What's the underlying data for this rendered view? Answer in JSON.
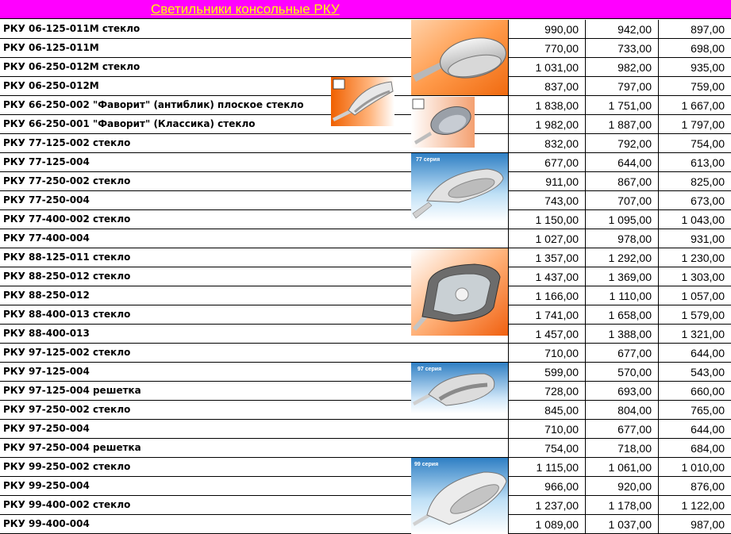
{
  "title": "Светильники консольные РКУ",
  "rows": [
    {
      "name": "РКУ 06-125-011М стекло",
      "p1": "990,00",
      "p2": "942,00",
      "p3": "897,00"
    },
    {
      "name": "РКУ 06-125-011М",
      "p1": "770,00",
      "p2": "733,00",
      "p3": "698,00"
    },
    {
      "name": "РКУ 06-250-012М стекло",
      "p1": "1 031,00",
      "p2": "982,00",
      "p3": "935,00"
    },
    {
      "name": "РКУ 06-250-012М",
      "p1": "837,00",
      "p2": "797,00",
      "p3": "759,00"
    },
    {
      "name": "РКУ 66-250-002 \"Фаворит\" (антиблик) плоское стекло",
      "p1": "1 838,00",
      "p2": "1 751,00",
      "p3": "1 667,00"
    },
    {
      "name": "РКУ 66-250-001 \"Фаворит\" (Классика) стекло",
      "p1": "1 982,00",
      "p2": "1 887,00",
      "p3": "1 797,00"
    },
    {
      "name": "РКУ 77-125-002 стекло",
      "p1": "832,00",
      "p2": "792,00",
      "p3": "754,00"
    },
    {
      "name": "РКУ 77-125-004",
      "p1": "677,00",
      "p2": "644,00",
      "p3": "613,00"
    },
    {
      "name": "РКУ 77-250-002 стекло",
      "p1": "911,00",
      "p2": "867,00",
      "p3": "825,00"
    },
    {
      "name": "РКУ 77-250-004",
      "p1": "743,00",
      "p2": "707,00",
      "p3": "673,00"
    },
    {
      "name": "РКУ 77-400-002 стекло",
      "p1": "1 150,00",
      "p2": "1 095,00",
      "p3": "1 043,00"
    },
    {
      "name": "РКУ 77-400-004",
      "p1": "1 027,00",
      "p2": "978,00",
      "p3": "931,00"
    },
    {
      "name": "РКУ 88-125-011 стекло",
      "p1": "1 357,00",
      "p2": "1 292,00",
      "p3": "1 230,00"
    },
    {
      "name": "РКУ 88-250-012 стекло",
      "p1": "1 437,00",
      "p2": "1 369,00",
      "p3": "1 303,00"
    },
    {
      "name": "РКУ 88-250-012",
      "p1": "1 166,00",
      "p2": "1 110,00",
      "p3": "1 057,00"
    },
    {
      "name": "РКУ 88-400-013 стекло",
      "p1": "1 741,00",
      "p2": "1 658,00",
      "p3": "1 579,00"
    },
    {
      "name": "РКУ 88-400-013",
      "p1": "1 457,00",
      "p2": "1 388,00",
      "p3": "1 321,00"
    },
    {
      "name": "РКУ 97-125-002 стекло",
      "p1": "710,00",
      "p2": "677,00",
      "p3": "644,00"
    },
    {
      "name": "РКУ 97-125-004",
      "p1": "599,00",
      "p2": "570,00",
      "p3": "543,00"
    },
    {
      "name": "РКУ 97-125-004 решетка",
      "p1": "728,00",
      "p2": "693,00",
      "p3": "660,00"
    },
    {
      "name": "РКУ 97-250-002 стекло",
      "p1": "845,00",
      "p2": "804,00",
      "p3": "765,00"
    },
    {
      "name": "РКУ 97-250-004",
      "p1": "710,00",
      "p2": "677,00",
      "p3": "644,00"
    },
    {
      "name": "РКУ 97-250-004 решетка",
      "p1": "754,00",
      "p2": "718,00",
      "p3": "684,00"
    },
    {
      "name": "РКУ 99-250-002 стекло",
      "p1": "1 115,00",
      "p2": "1 061,00",
      "p3": "1 010,00"
    },
    {
      "name": "РКУ 99-250-004",
      "p1": "966,00",
      "p2": "920,00",
      "p3": "876,00"
    },
    {
      "name": "РКУ 99-400-002 стекло",
      "p1": "1 237,00",
      "p2": "1 178,00",
      "p3": "1 122,00"
    },
    {
      "name": "РКУ 99-400-004",
      "p1": "1 089,00",
      "p2": "1 037,00",
      "p3": "987,00"
    }
  ],
  "photos": {
    "series77": "77 серия",
    "series97": "97 серия",
    "series99": "99 серия"
  },
  "colors": {
    "header_bg": "#ff00ff",
    "header_text": "#ffff00"
  }
}
